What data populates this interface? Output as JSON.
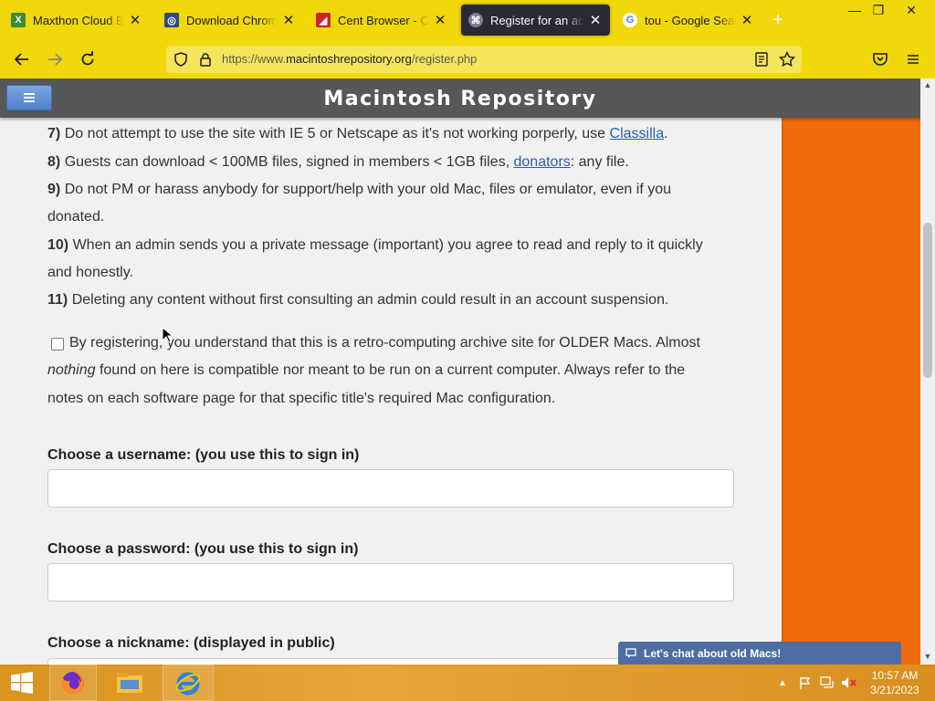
{
  "browser": {
    "tabs": [
      {
        "title": "Maxthon Cloud Brow",
        "favicon": "maxthon-icon",
        "fav_color": "#3a8a3a",
        "fav_glyph": "X"
      },
      {
        "title": "Download Chromodo",
        "favicon": "chromodo-icon",
        "fav_color": "#2a4a8a",
        "fav_glyph": "◎"
      },
      {
        "title": "Cent Browser - Скач",
        "favicon": "cent-icon",
        "fav_color": "#d0202a",
        "fav_glyph": "◢"
      },
      {
        "title": "Register for an accou",
        "favicon": "macrepo-icon",
        "fav_color": "#7a7a9a",
        "fav_glyph": "⌘",
        "active": true
      },
      {
        "title": "tou - Google Search",
        "favicon": "google-icon",
        "fav_color": "#ffffff",
        "fav_glyph": "G"
      }
    ],
    "new_tab_label": "+",
    "close_glyph": "✕",
    "window_controls": {
      "minimize": "—",
      "restore": "❐",
      "close": "✕"
    },
    "url": {
      "prefix": "https://www.",
      "domain": "macintoshrepository.org",
      "path": "/register.php"
    }
  },
  "site": {
    "title": "Macintosh Repository",
    "menu_icon": "hamburger-icon",
    "accent": "#f06a0c"
  },
  "rules": [
    {
      "num": "7)",
      "text_before": "Do not attempt to use the site with IE 5 or Netscape as it's not working porperly, use ",
      "link": "Classilla",
      "text_after": "."
    },
    {
      "num": "8)",
      "text_before": "Guests can download < 100MB files, signed in members < 1GB files, ",
      "link": "donators",
      "text_after": ": any file."
    },
    {
      "num": "9)",
      "line1": "Do not PM or harass anybody for support/help with your old Mac, files or emulator, even if you",
      "line2": "donated."
    },
    {
      "num": "10)",
      "line1": "When an admin sends you a private message (important) you agree to read and reply to it quickly",
      "line2": "and honestly."
    },
    {
      "num": "11)",
      "text": "Deleting any content without first consulting an admin could result in an account suspension."
    }
  ],
  "agreement": {
    "checked": false,
    "line1": "By registering, you understand that this is a retro-computing archive site for OLDER Macs. Almost",
    "line2_em": "nothing",
    "line2_rest": " found on here is compatible nor meant to be run on a current computer. Always refer to the",
    "line3": "notes on each software page for that specific title's required Mac configuration."
  },
  "form": {
    "username_label": "Choose a username: (you use this to sign in)",
    "username_value": "",
    "password_label": "Choose a password: (you use this to sign in)",
    "password_value": "",
    "nickname_label": "Choose a nickname: (displayed in public)"
  },
  "chat": {
    "label": "Let's chat about old Macs!",
    "icon": "chat-icon"
  },
  "taskbar": {
    "items": [
      "start-button",
      "firefox-icon",
      "file-explorer-icon",
      "internet-explorer-icon"
    ],
    "time": "10:57 AM",
    "date": "3/21/2023"
  }
}
